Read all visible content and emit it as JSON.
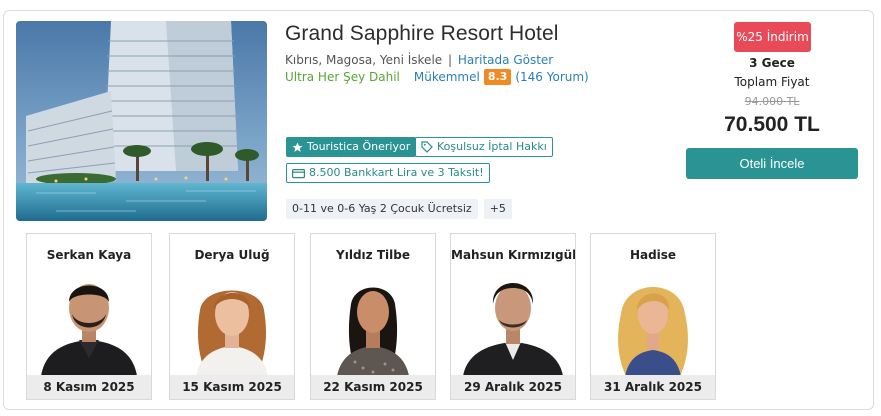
{
  "hotel": {
    "name": "Grand Sapphire Resort Hotel",
    "location": "Kıbrıs, Magosa, Yeni İskele",
    "map_link": "Haritada Göster",
    "concept": "Ultra Her Şey Dahil",
    "rating_word": "Mükemmel",
    "score": "8.3",
    "reviews": "(146 Yorum)"
  },
  "badges": {
    "recommended": "Touristica Öneriyor",
    "free_cancel": "Koşulsuz İptal Hakkı",
    "bank_offer": "8.500 Bankkart Lira ve 3 Taksit!"
  },
  "tags": {
    "children": "0-11 ve 0-6 Yaş 2 Çocuk Ücretsiz",
    "more": "+5"
  },
  "pricing": {
    "discount": "%25 İndirim",
    "nights": "3 Gece",
    "total_label": "Toplam Fiyat",
    "old_price": "94.000 TL",
    "price": "70.500 TL",
    "cta": "Oteli İncele"
  },
  "artists": [
    {
      "name": "Serkan Kaya",
      "date": "8 Kasım 2025"
    },
    {
      "name": "Derya Uluğ",
      "date": "15 Kasım 2025"
    },
    {
      "name": "Yıldız Tilbe",
      "date": "22 Kasım 2025"
    },
    {
      "name": "Mahsun Kırmızıgül",
      "date": "29 Aralık 2025"
    },
    {
      "name": "Hadise",
      "date": "31 Aralık 2025"
    }
  ],
  "colors": {
    "accent": "#2a9494",
    "discount": "#e84a57",
    "score": "#f08a24",
    "link": "#2b7fb8",
    "concept": "#57a639"
  },
  "icons": {
    "recommended": "star-icon",
    "free_cancel": "tag-icon",
    "bank_offer": "card-icon"
  }
}
